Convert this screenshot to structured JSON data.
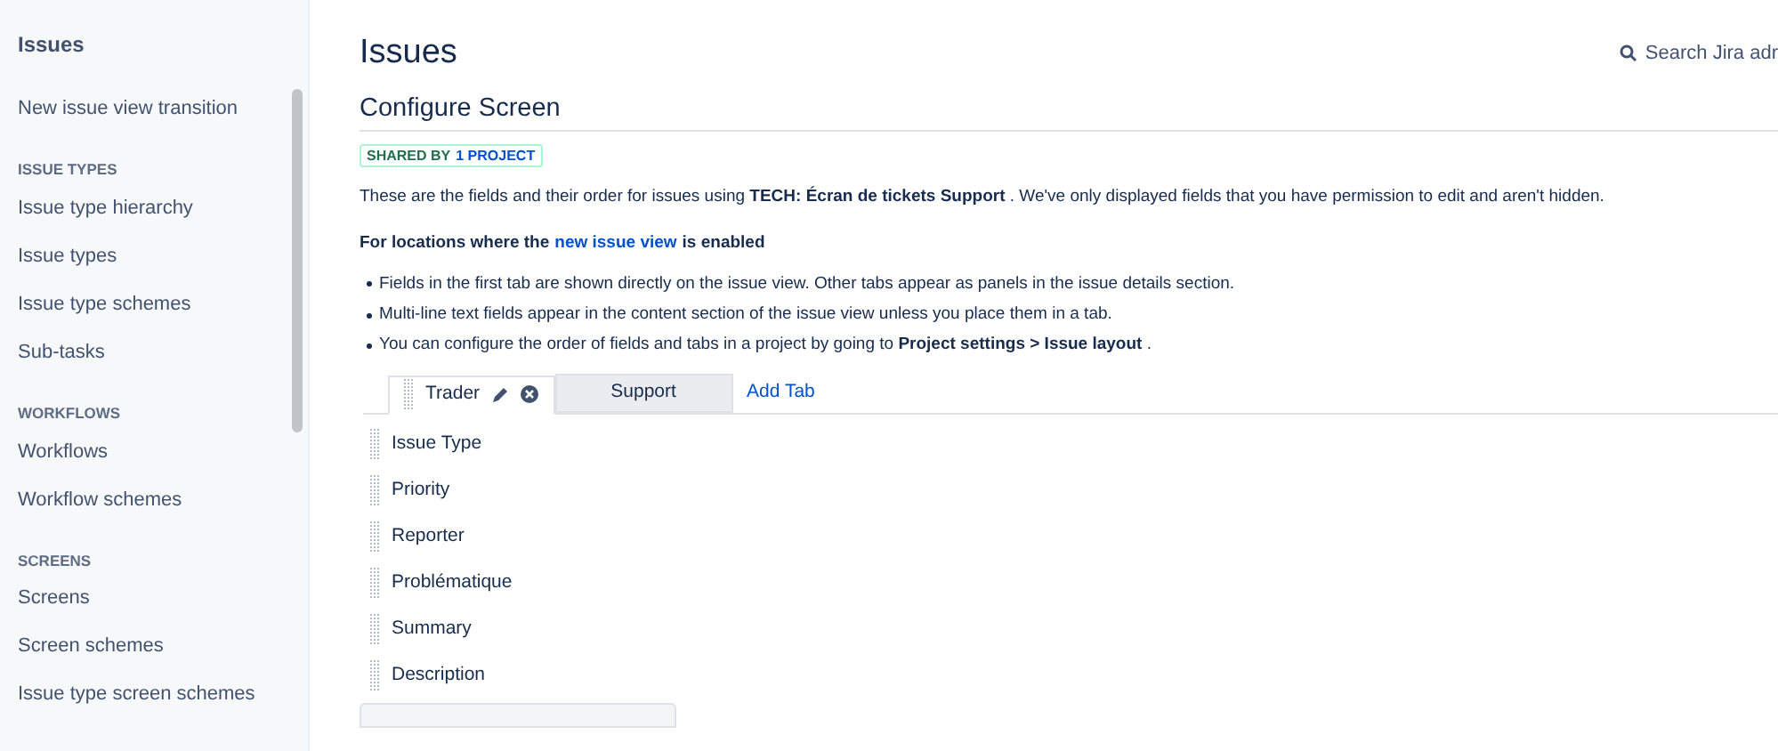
{
  "sidebar": {
    "title": "Issues",
    "sections": [
      {
        "items": [
          {
            "label": "New issue view transition"
          }
        ]
      },
      {
        "heading": "ISSUE TYPES",
        "items": [
          {
            "label": "Issue type hierarchy"
          },
          {
            "label": "Issue types"
          },
          {
            "label": "Issue type schemes"
          },
          {
            "label": "Sub-tasks"
          }
        ]
      },
      {
        "heading": "WORKFLOWS",
        "items": [
          {
            "label": "Workflows"
          },
          {
            "label": "Workflow schemes"
          }
        ]
      },
      {
        "heading": "SCREENS",
        "items": [
          {
            "label": "Screens"
          },
          {
            "label": "Screen schemes"
          },
          {
            "label": "Issue type screen schemes"
          }
        ]
      }
    ]
  },
  "header": {
    "title": "Issues",
    "search": "Search Jira adr"
  },
  "page": {
    "title": "Configure Screen",
    "badge": {
      "prefix": "SHARED BY",
      "link": "1 PROJECT"
    },
    "intro": "These are the fields and their order for issues using **TECH: Écran de tickets Support** . We've only displayed fields that you have permission to edit and aren't hidden.",
    "note": {
      "before": "For locations where the",
      "link": "new issue view",
      "after": "is enabled"
    },
    "bullets": [
      "Fields in the first tab are shown directly on the issue view. Other tabs appear as panels in the issue details section.",
      "Multi-line text fields appear in the content section of the issue view unless you place them in a tab.",
      "You can configure the order of fields and tabs in a project by going to **Project settings > Issue layout** ."
    ],
    "tabs": [
      {
        "label": "Trader",
        "selected": true
      },
      {
        "label": "Support",
        "selected": false
      }
    ],
    "add_tab": "Add Tab",
    "fields": [
      "Issue Type",
      "Priority",
      "Reporter",
      "Problématique",
      "Summary",
      "Description"
    ]
  }
}
